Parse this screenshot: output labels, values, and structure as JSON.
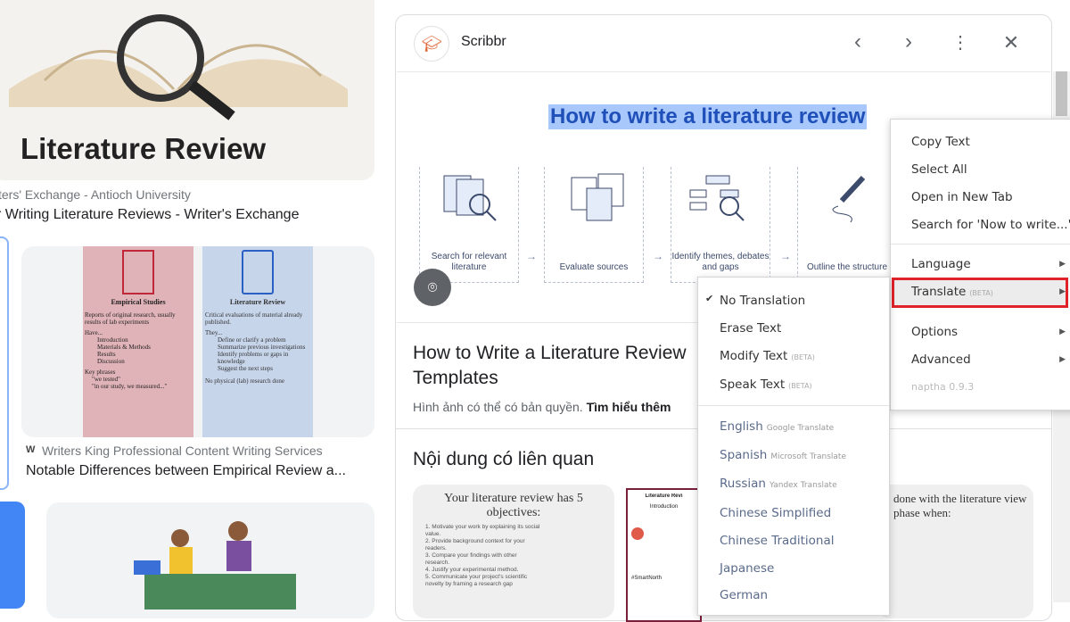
{
  "left_results": [
    {
      "image_text": "Literature Review",
      "source": "ters' Exchange - Antioch University",
      "title": "r Writing Literature Reviews - Writer's Exchange"
    },
    {
      "image": {
        "empirical_title": "Empirical Studies",
        "empirical_desc": "Reports of original research, usually results of lab experiments",
        "empirical_have": "Have...",
        "empirical_items": [
          "Introduction",
          "Materials & Methods",
          "Results",
          "Discussion"
        ],
        "empirical_key": "Key phrases",
        "empirical_phrases": [
          "\"we tested\"",
          "\"in our study, we measured...\""
        ],
        "review_title": "Literature Review",
        "review_desc": "Critical evaluations of material already published.",
        "review_they": "They...",
        "review_items": [
          "Define or clarify a problem",
          "Summarize previous investigations",
          "Identify problems or gaps in knowledge",
          "Suggest the next steps"
        ],
        "review_note": "No physical (lab) research done"
      },
      "source": "Writers King Professional Content Writing Services",
      "title": "Notable Differences between Empirical Review a..."
    }
  ],
  "panel": {
    "site_name": "Scribbr",
    "image_title": "How to write a literature review",
    "steps": [
      "Search for relevant literature",
      "Evaluate sources",
      "Identify themes, debates and gaps",
      "Outline the structure"
    ],
    "heading": "How to Write a Literature Review Templates",
    "copyright": "Hình ảnh có thể có bản quyền.",
    "learn_more": "Tìm hiểu thêm",
    "related_heading": "Nội dung có liên quan",
    "related": [
      {
        "title": "Your literature review has 5 objectives:",
        "items": [
          "1. Motivate your work by explaining its social value.",
          "2. Provide background context for your readers.",
          "3. Compare your findings with other research.",
          "4. Justify your experimental method.",
          "5. Communicate your project's scientific novelty by framing a research gap"
        ]
      },
      {
        "title": "Literature Revi",
        "sub": "Introduction",
        "tag": "#SmartNorth"
      },
      {
        "title": "done with the literature view phase when:"
      }
    ]
  },
  "context_menu": {
    "items": [
      "Copy Text",
      "Select All",
      "Open in New Tab",
      "Search for 'Now to write...'"
    ],
    "language": "Language",
    "translate": "Translate",
    "beta": "(BETA)",
    "options": "Options",
    "advanced": "Advanced",
    "version": "naptha 0.9.3"
  },
  "translate_menu": {
    "actions": [
      {
        "label": "No Translation",
        "checked": true,
        "beta": ""
      },
      {
        "label": "Erase Text",
        "beta": ""
      },
      {
        "label": "Modify Text",
        "beta": "(BETA)"
      },
      {
        "label": "Speak Text",
        "beta": "(BETA)"
      }
    ],
    "languages": [
      {
        "label": "English",
        "provider": "Google Translate"
      },
      {
        "label": "Spanish",
        "provider": "Microsoft Translate"
      },
      {
        "label": "Russian",
        "provider": "Yandex Translate"
      },
      {
        "label": "Chinese Simplified",
        "provider": ""
      },
      {
        "label": "Chinese Traditional",
        "provider": ""
      },
      {
        "label": "Japanese",
        "provider": ""
      },
      {
        "label": "German",
        "provider": ""
      }
    ]
  },
  "colors": {
    "highlight": "#a8c7fa",
    "title_blue": "#1f4fb8",
    "red_outline": "#e0222a",
    "blue_tile": "#4285f4"
  }
}
